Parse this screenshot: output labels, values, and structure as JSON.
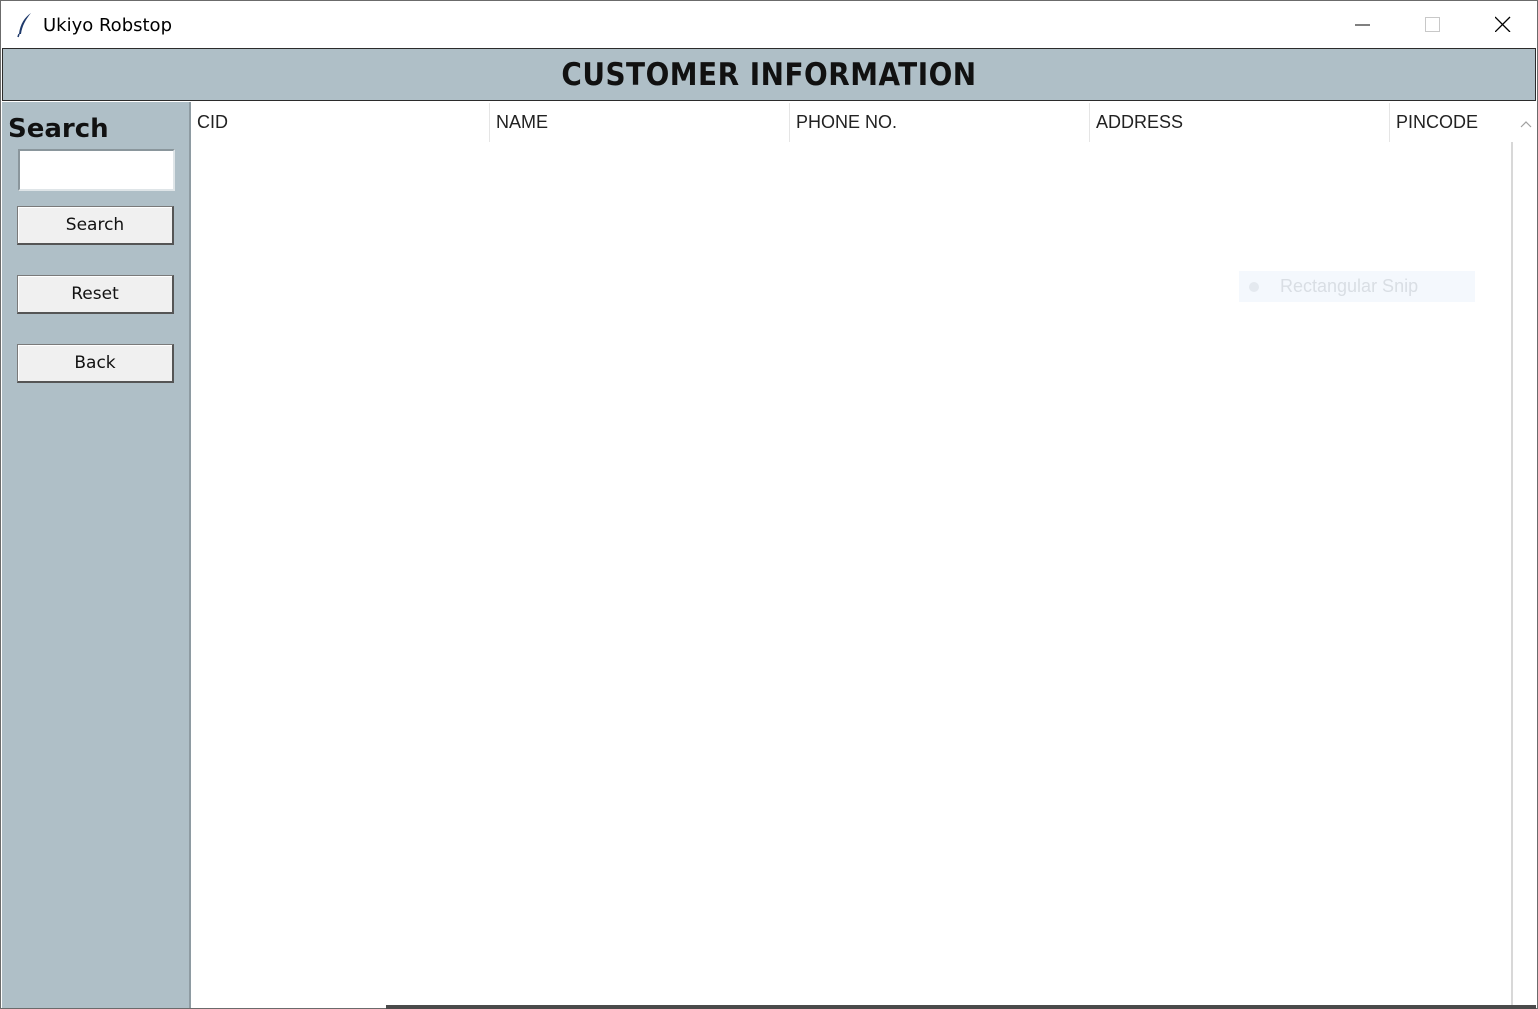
{
  "window": {
    "title": "Ukiyo Robstop",
    "icon": "feather-icon"
  },
  "header": {
    "title": "CUSTOMER INFORMATION"
  },
  "sidebar": {
    "search_label": "Search",
    "search_value": "",
    "buttons": {
      "search": "Search",
      "reset": "Reset",
      "back": "Back"
    }
  },
  "table": {
    "columns": [
      "CID",
      "NAME",
      "PHONE NO.",
      "ADDRESS",
      "PINCODE"
    ],
    "rows": []
  },
  "overlay": {
    "snip_label": "Rectangular Snip"
  },
  "colors": {
    "panel": "#afbfc7",
    "banner_border": "#2b2b2b",
    "window_bg": "#ffffff"
  }
}
